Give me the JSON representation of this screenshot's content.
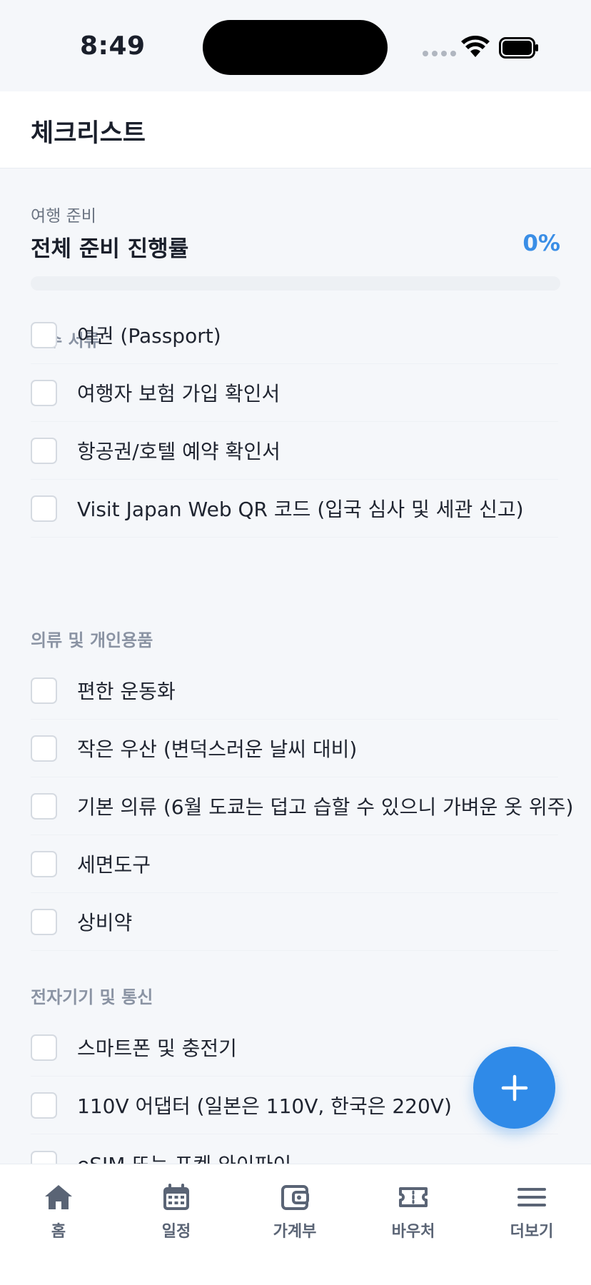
{
  "status_bar": {
    "time": "8:49"
  },
  "header": {
    "title": "체크리스트"
  },
  "progress": {
    "label": "여행 준비",
    "title": "전체 준비 진행률",
    "percent_text": "0%",
    "value": 0
  },
  "categories": [
    {
      "title": "필수 서류"
    },
    {
      "title": "의류 및 개인용품"
    },
    {
      "title": "전자기기 및 통신"
    }
  ],
  "items": [
    {
      "label": "여권 (Passport)",
      "checked": false
    },
    {
      "label": "여행자 보험 가입 확인서",
      "checked": false
    },
    {
      "label": "항공권/호텔 예약 확인서",
      "checked": false
    },
    {
      "label": "Visit Japan Web QR 코드 (입국 심사 및 세관 신고)",
      "checked": false
    },
    {
      "label": "편한 운동화",
      "checked": false
    },
    {
      "label": "작은 우산 (변덕스러운 날씨 대비)",
      "checked": false
    },
    {
      "label": "기본 의류 (6월 도쿄는 덥고 습할 수 있으니 가벼운 옷 위주)",
      "checked": false
    },
    {
      "label": "세면도구",
      "checked": false
    },
    {
      "label": "상비약",
      "checked": false
    },
    {
      "label": "스마트폰 및 충전기",
      "checked": false
    },
    {
      "label": "110V 어댑터 (일본은 110V, 한국은 220V)",
      "checked": false
    },
    {
      "label": "eSIM 또는 포켓 와이파이",
      "checked": false
    }
  ],
  "fab": {
    "icon": "plus-icon"
  },
  "tab_bar": [
    {
      "label": "홈",
      "icon": "home-icon"
    },
    {
      "label": "일정",
      "icon": "calendar-icon"
    },
    {
      "label": "가계부",
      "icon": "wallet-icon"
    },
    {
      "label": "바우처",
      "icon": "ticket-icon"
    },
    {
      "label": "더보기",
      "icon": "menu-icon"
    }
  ],
  "colors": {
    "accent": "#2F8AE8",
    "background": "#F5F7FA",
    "text": "#1A1F2B",
    "muted": "#8A93A3"
  }
}
